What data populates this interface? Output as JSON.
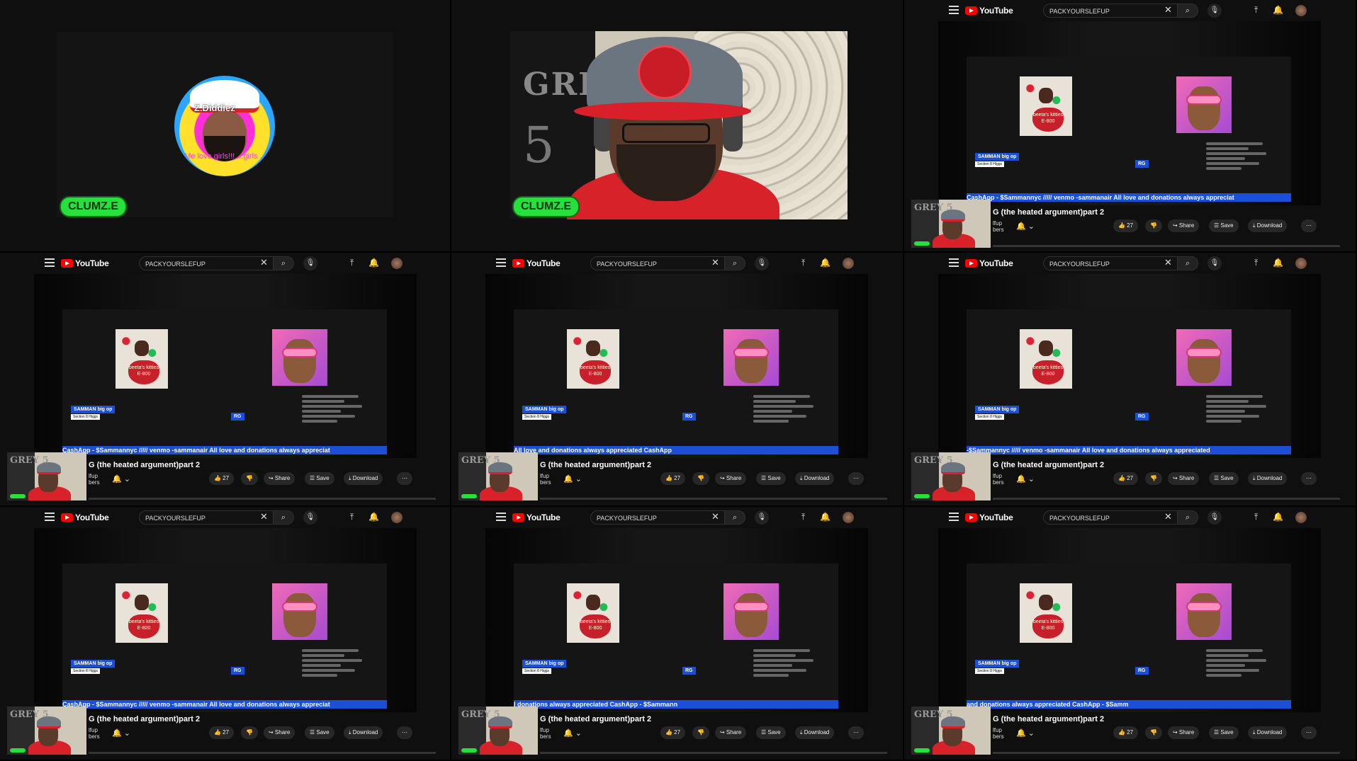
{
  "webcam_tiles": {
    "badge_label": "CLUMZ.E",
    "avatar": {
      "name_text": "Z.Diddiez",
      "caption_text": "Me love girls!!! ...girls ...",
      "icon": "profile-avatar-icon"
    },
    "backdrop_flag": {
      "text": "GRE",
      "number": "5"
    }
  },
  "youtube": {
    "logo_text": "YouTube",
    "search_value": "PACKYOURSLEFUP",
    "clear_glyph": "✕",
    "search_glyph": "⌕",
    "mic_glyph": "🎙",
    "upload_glyph": "⤒",
    "bell_glyph": "🔔",
    "video_title": "G (the heated argument)part 2",
    "channel_lines": [
      "lfup",
      "bers"
    ],
    "subscribe_bell_glyph": "🔔 ⌄",
    "like_label": "👍 27",
    "dislike_label": "👎",
    "share_label": "↪ Share",
    "save_label": "☰ Save",
    "download_label": "⤓ Download",
    "more_label": "⋯",
    "stage": {
      "samman_label": "SAMMAN big op",
      "section_label": "Section 8 Higgs",
      "rg_label": "RG",
      "heart_text": "beeta's kitties E-800",
      "pip_text": "GREY 5"
    }
  },
  "tickers": [
    "CashApp - $Sammannyc ///// venmo -sammanair All love and donations always appreciat",
    "CashApp - $Sammannyc ///// venmo -sammanair All love and donations always appreciat",
    "All love and donations always appreciated                                CashApp",
    "-$Sammannyc ///// venmo -sammanair All love and donations always appreciated",
    "CashApp - $Sammannyc ///// venmo -sammanair All love and donations always appreciat",
    "l donations always appreciated                                    CashApp - $Sammann",
    "and donations always appreciated                                  CashApp - $Samm"
  ],
  "colors": {
    "badge_green": "#27e03b",
    "ticker_blue": "#1a4fd6",
    "youtube_red": "#ff0000",
    "background": "#0f0f0f"
  }
}
